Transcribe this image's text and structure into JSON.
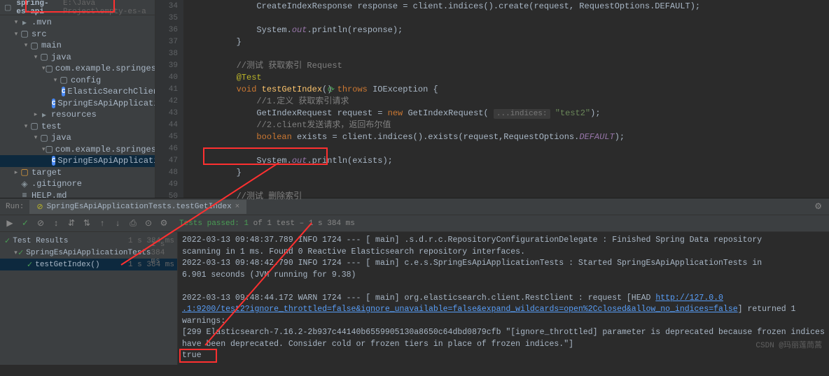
{
  "breadcrumb": {
    "project": "spring-es-api",
    "path": "E:\\Java Project\\empty-es-a"
  },
  "tree": {
    "items": [
      {
        "indent": 1,
        "arrow": "▾",
        "icon": "dir",
        "label": ".mvn"
      },
      {
        "indent": 1,
        "arrow": "▾",
        "icon": "src",
        "label": "src"
      },
      {
        "indent": 2,
        "arrow": "▾",
        "icon": "src",
        "label": "main"
      },
      {
        "indent": 3,
        "arrow": "▾",
        "icon": "src",
        "label": "java"
      },
      {
        "indent": 4,
        "arrow": "▾",
        "icon": "pkg",
        "label": "com.example.springesapi"
      },
      {
        "indent": 5,
        "arrow": "▾",
        "icon": "pkg",
        "label": "config"
      },
      {
        "indent": 6,
        "arrow": "",
        "icon": "class",
        "label": "ElasticSearchClientConf"
      },
      {
        "indent": 5,
        "arrow": "",
        "icon": "class",
        "label": "SpringEsApiApplication"
      },
      {
        "indent": 3,
        "arrow": "▸",
        "icon": "dir",
        "label": "resources"
      },
      {
        "indent": 2,
        "arrow": "▾",
        "icon": "src",
        "label": "test"
      },
      {
        "indent": 3,
        "arrow": "▾",
        "icon": "src",
        "label": "java"
      },
      {
        "indent": 4,
        "arrow": "▾",
        "icon": "pkg",
        "label": "com.example.springesapi"
      },
      {
        "indent": 5,
        "arrow": "",
        "icon": "class",
        "label": "SpringEsApiApplicationTes",
        "selected": true
      },
      {
        "indent": 1,
        "arrow": "▸",
        "icon": "target",
        "label": "target"
      },
      {
        "indent": 1,
        "arrow": "",
        "icon": "git",
        "label": ".gitignore"
      },
      {
        "indent": 1,
        "arrow": "",
        "icon": "file",
        "label": "HELP.md"
      }
    ]
  },
  "gutter": [
    "34",
    "35",
    "36",
    "37",
    "38",
    "39",
    "40",
    "41",
    "42",
    "43",
    "44",
    "45",
    "46",
    "47",
    "48",
    "49",
    "50"
  ],
  "code": {
    "l34": "            CreateIndexResponse response = client.indices().create(request, RequestOptions.DEFAULT);",
    "l35": "",
    "l36_a": "            System.",
    "l36_field": "out",
    "l36_b": ".println(response);",
    "l37": "        }",
    "l38": "",
    "l39_c": "        //测试 获取索引 Request",
    "l40_a": "        ",
    "l40_anno": "@Test",
    "l41_a": "        ",
    "l41_kw1": "void",
    "l41_b": " ",
    "l41_m": "testGetIndex",
    "l41_c": "() ",
    "l41_kw2": "throws",
    "l41_d": " IOException {",
    "l42_c": "            //1.定义 获取索引请求",
    "l43_a": "            GetIndexRequest request = ",
    "l43_kw": "new",
    "l43_b": " GetIndexRequest( ",
    "l43_hint": "...indices:",
    "l43_c": " ",
    "l43_str": "\"test2\"",
    "l43_d": ");",
    "l44_c": "            //2.client发送请求，返回布尔值",
    "l45_a": "            ",
    "l45_kw": "boolean",
    "l45_b": " exists = client.indices().exists(request,RequestOptions.",
    "l45_const": "DEFAULT",
    "l45_c": ");",
    "l46": "",
    "l47_a": "            System.",
    "l47_field": "out",
    "l47_b": ".println(exists);",
    "l48": "        }",
    "l49": "",
    "l50_c": "        //测试 删除索引"
  },
  "run": {
    "label": "Run:",
    "tab": "SpringEsApiApplicationTests.testGetIndex",
    "tests_passed": "Tests passed: 1",
    "tests_total": " of 1 test – 1 s 384 ms"
  },
  "tests": {
    "root": {
      "label": "Test Results",
      "time": "1 s 384 ms"
    },
    "class": {
      "label": "SpringEsApiApplicationTests",
      "time": "1 s 384 ms"
    },
    "method": {
      "label": "testGetIndex()",
      "time": "1 s 384 ms"
    }
  },
  "console": {
    "l1": "2022-03-13 09:48:37.789  INFO 1724 --- [           main] .s.d.r.c.RepositoryConfigurationDelegate : Finished Spring Data repository ",
    "l1b": " scanning in 1 ms. Found 0 Reactive Elasticsearch repository interfaces.",
    "l2": "2022-03-13 09:48:42.790  INFO 1724 --- [           main] c.e.s.SpringEsApiApplicationTests        : Started SpringEsApiApplicationTests in ",
    "l2b": " 6.901 seconds (JVM running for 9.38)",
    "l3a": "2022-03-13 09:48:44.172  WARN 1724 --- [           main] org.elasticsearch.client.RestClient      : request [HEAD ",
    "l3link1": "http://127.0.0",
    "l3link2": ".1:9200/test2?ignore_throttled=false&ignore_unavailable=false&expand_wildcards=open%2Cclosed&allow_no_indices=false",
    "l3b": "] returned 1 warnings: ",
    "l4": " [299 Elasticsearch-7.16.2-2b937c44140b6559905130a8650c64dbd0879cfb \"[ignore_throttled] parameter is deprecated because frozen indices ",
    "l4b": " have been deprecated. Consider cold or frozen tiers in place of frozen indices.\"]",
    "l5": "true"
  },
  "watermark": "CSDN @玛丽莲茼蒿"
}
